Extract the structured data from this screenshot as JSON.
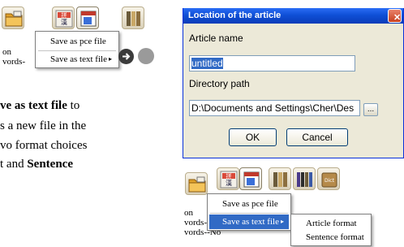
{
  "top_panel": {
    "side_lines": [
      "on",
      "vords-"
    ],
    "menu": {
      "items": [
        {
          "label": "Save as pce file"
        },
        {
          "label": "Save as text file",
          "arrow": "▸"
        }
      ]
    }
  },
  "paragraph": {
    "line1": {
      "bold": "ve as text file",
      "rest": " to"
    },
    "line2": "s a new file in the",
    "line3": "vo format choices",
    "line4": {
      "pre": "t and ",
      "bold": "Sentence"
    }
  },
  "dialog": {
    "title": "Location of the article",
    "close_glyph": "✕",
    "article_name_label": "Article name",
    "article_name_value": "untitled",
    "directory_label": "Directory path",
    "directory_value": "D:\\Documents and Settings\\Cher\\Des",
    "browse_label": "...",
    "ok_label": "OK",
    "cancel_label": "Cancel"
  },
  "bottom_panel": {
    "side_lines": [
      "on",
      "vords-",
      "vords--No"
    ],
    "menu": {
      "items": [
        {
          "label": "Save as pce file"
        },
        {
          "label": "Save as text file",
          "arrow": "▸"
        }
      ]
    },
    "submenu": {
      "items": [
        {
          "label": "Article format"
        },
        {
          "label": "Sentence format"
        }
      ]
    },
    "dict_icon_label": "Dict"
  },
  "colors": {
    "titlebar": "#0f4fd6",
    "selection": "#316ac5",
    "dialog_bg": "#ece9d8"
  }
}
